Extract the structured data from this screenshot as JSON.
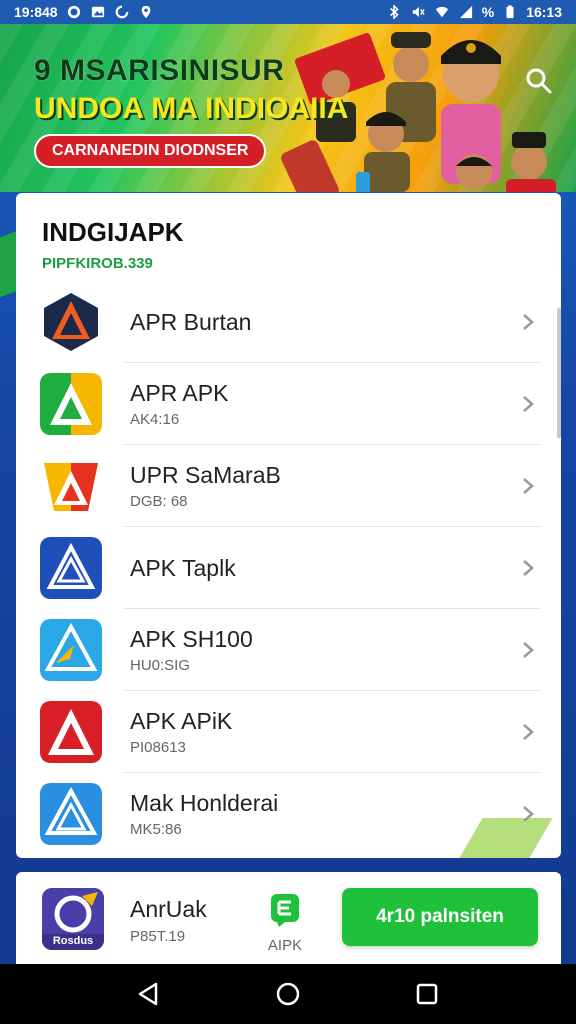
{
  "status_bar": {
    "time_left": "19:848",
    "signal_text": "%",
    "time_right": "16:13"
  },
  "banner": {
    "line1": "9 MSARISINISUR",
    "line2": "UNDOA MA INDIOAIIA",
    "pill": "CARNANEDIN DIODNSER"
  },
  "card": {
    "title": "INDGIJAPK",
    "subtitle": "PIPFKIROB.339"
  },
  "apps": [
    {
      "name": "APR Burtan",
      "sub": ""
    },
    {
      "name": "APR APK",
      "sub": "AK4:16"
    },
    {
      "name": "UPR SaMaraB",
      "sub": "DGB: 68"
    },
    {
      "name": "APK Taplk",
      "sub": ""
    },
    {
      "name": "APK SH100",
      "sub": "HU0:SIG"
    },
    {
      "name": "APK APiK",
      "sub": "PI08613"
    },
    {
      "name": "Mak Honlderai",
      "sub": "MK5:86"
    }
  ],
  "bottom": {
    "name": "AnrUak",
    "sub": "P85T.19",
    "icon_label": "Rosdus",
    "apk_label": "AIPK",
    "install_label": "4r10 palnsiten"
  },
  "colors": {
    "accent_green": "#1fc13b",
    "brand_blue": "#1f5bb0",
    "subtitle_green": "#1b9e3e"
  },
  "icons": {
    "status_left": [
      "whatsapp-icon",
      "gallery-icon",
      "sync-icon",
      "location-icon"
    ],
    "status_right": [
      "bluetooth-icon",
      "mute-icon",
      "wifi-icon",
      "signal-icon",
      "battery-icon"
    ],
    "nav": [
      "back-icon",
      "home-icon",
      "recents-icon"
    ]
  }
}
